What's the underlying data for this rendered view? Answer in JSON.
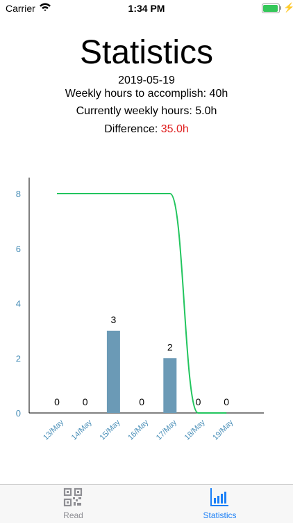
{
  "status_bar": {
    "carrier": "Carrier",
    "time": "1:34 PM",
    "battery_level": 0.95
  },
  "header": {
    "title": "Statistics",
    "date": "2019-05-19",
    "weekly_goal": "Weekly hours to accomplish: 40h",
    "current_hours": "Currently weekly hours: 5.0h",
    "difference_label": "Difference: ",
    "difference_value": "35.0h"
  },
  "colors": {
    "bar": "#6b9ab6",
    "line": "#22c55e",
    "axis_tick": "#4a8fb8",
    "difference": "#e02020",
    "tab_active": "#1a7ff7",
    "tab_inactive": "#8e8e93"
  },
  "chart_data": {
    "type": "bar",
    "categories": [
      "13/May",
      "14/May",
      "15/May",
      "16/May",
      "17/May",
      "18/May",
      "19/May"
    ],
    "series": [
      {
        "type": "bar",
        "values": [
          0,
          0,
          3,
          0,
          2,
          0,
          0
        ],
        "data_labels": [
          "0",
          "0",
          "3",
          "0",
          "2",
          "0",
          "0"
        ]
      },
      {
        "type": "line",
        "values": [
          8,
          8,
          8,
          8,
          8,
          0,
          0
        ]
      }
    ],
    "y_ticks": [
      "0",
      "2",
      "4",
      "6",
      "8"
    ],
    "ylim": [
      0,
      8
    ],
    "grid": false
  },
  "tabs": [
    {
      "label": "Read",
      "icon": "qr-code-icon",
      "active": false
    },
    {
      "label": "Statistics",
      "icon": "bar-chart-icon",
      "active": true
    }
  ]
}
